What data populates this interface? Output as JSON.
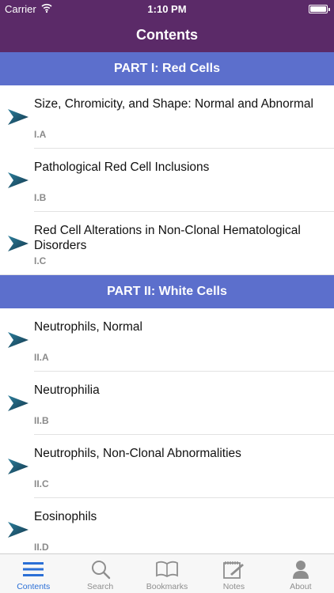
{
  "status_bar": {
    "carrier": "Carrier",
    "time": "1:10 PM"
  },
  "nav": {
    "title": "Contents"
  },
  "sections": [
    {
      "header": "PART I: Red Cells",
      "items": [
        {
          "title": "Size, Chromicity, and Shape: Normal and Abnormal",
          "code": "I.A"
        },
        {
          "title": "Pathological Red Cell Inclusions",
          "code": "I.B"
        },
        {
          "title": "Red Cell Alterations in Non-Clonal Hematological Disorders",
          "code": "I.C"
        }
      ]
    },
    {
      "header": "PART II: White Cells",
      "items": [
        {
          "title": "Neutrophils, Normal",
          "code": "II.A"
        },
        {
          "title": "Neutrophilia",
          "code": "II.B"
        },
        {
          "title": "Neutrophils, Non-Clonal Abnormalities",
          "code": "II.C"
        },
        {
          "title": "Eosinophils",
          "code": "II.D"
        }
      ]
    }
  ],
  "tabbar": {
    "items": [
      {
        "label": "Contents",
        "icon": "list-icon",
        "active": true
      },
      {
        "label": "Search",
        "icon": "search-icon"
      },
      {
        "label": "Bookmarks",
        "icon": "book-icon"
      },
      {
        "label": "Notes",
        "icon": "notes-icon"
      },
      {
        "label": "About",
        "icon": "person-icon"
      }
    ]
  },
  "colors": {
    "nav_bar": "#5b2a68",
    "section_header": "#5c6fcc",
    "arrow": "#1f5c78",
    "tab_active": "#2b6fd6",
    "tab_inactive": "#8e8e8e"
  }
}
